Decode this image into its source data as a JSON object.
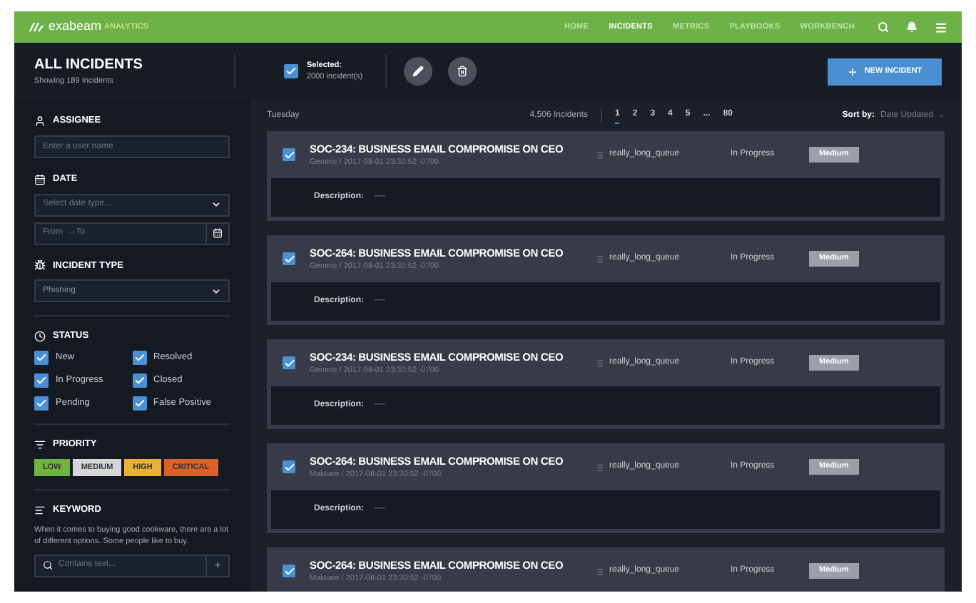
{
  "nav": {
    "logo": "exabeam",
    "logo_suffix": "ANALYTICS",
    "items": [
      {
        "label": "HOME",
        "selected": false
      },
      {
        "label": "INCIDENTS",
        "selected": true
      },
      {
        "label": "METRICS",
        "selected": false
      },
      {
        "label": "PLAYBOOKS",
        "selected": false
      },
      {
        "label": "WORKBENCH",
        "selected": false
      }
    ]
  },
  "header": {
    "title": "ALL INCIDENTS",
    "subtitle": "Showing 189 Incidents",
    "selection": {
      "checked": true,
      "label": "Selected:",
      "count": "2000 incident(s)"
    },
    "new_button": "NEW INCIDENT"
  },
  "filters": {
    "assignee": {
      "label": "ASSIGNEE",
      "placeholder": "Enter a user name"
    },
    "date": {
      "label": "DATE",
      "select_placeholder": "Select date type...",
      "range_placeholder": "From  →To"
    },
    "incident_type": {
      "label": "INCIDENT TYPE",
      "value": "Phishing"
    },
    "status": {
      "label": "STATUS",
      "options": [
        {
          "label": "New",
          "checked": true
        },
        {
          "label": "Resolved",
          "checked": true
        },
        {
          "label": "In Progress",
          "checked": true
        },
        {
          "label": "Closed",
          "checked": true
        },
        {
          "label": "Pending",
          "checked": true
        },
        {
          "label": "False Positive",
          "checked": true
        }
      ]
    },
    "priority": {
      "label": "PRIORITY",
      "options": [
        {
          "label": "LOW",
          "color": "#6db33f"
        },
        {
          "label": "MEDIUM",
          "color": "#d4d6d9"
        },
        {
          "label": "HIGH",
          "color": "#e8b23a"
        },
        {
          "label": "CRITICAL",
          "color": "#d9622b"
        }
      ]
    },
    "keyword": {
      "label": "KEYWORD",
      "hint": "When it comes to buying good cookware, there are a lot of different options. Some people like to buy.",
      "placeholder": "Contains text...",
      "add": "+"
    }
  },
  "list": {
    "day": "Tuesday",
    "count": "4,506 Incidents",
    "pages": [
      {
        "label": "1",
        "selected": true
      },
      {
        "label": "2",
        "selected": false
      },
      {
        "label": "3",
        "selected": false
      },
      {
        "label": "4",
        "selected": false
      },
      {
        "label": "5",
        "selected": false
      },
      {
        "label": "...",
        "selected": false
      },
      {
        "label": "80",
        "selected": false
      }
    ],
    "sort_label": "Sort by:",
    "sort_value": "Date Updated"
  },
  "incidents": [
    {
      "title": "SOC-234: BUSINESS EMAIL COMPROMISE ON CEO",
      "meta": "Generic / 2017-08-01 23:30:52 -0700",
      "queue": "really_long_queue",
      "status": "In Progress",
      "priority": "Medium",
      "checked": true,
      "description_label": "Description:",
      "description": "----"
    },
    {
      "title": "SOC-264: BUSINESS EMAIL COMPROMISE ON CEO",
      "meta": "Generic / 2017-08-01 23:30:52 -0700",
      "queue": "really_long_queue",
      "status": "In Progress",
      "priority": "Medium",
      "checked": true,
      "description_label": "Description:",
      "description": "----"
    },
    {
      "title": "SOC-234: BUSINESS EMAIL COMPROMISE ON CEO",
      "meta": "Generic / 2017-08-01 23:30:52 -0700",
      "queue": "really_long_queue",
      "status": "In Progress",
      "priority": "Medium",
      "checked": true,
      "description_label": "Description:",
      "description": "----"
    },
    {
      "title": "SOC-264: BUSINESS EMAIL COMPROMISE ON CEO",
      "meta": "Malware / 2017-08-01 23:30:52 -0700",
      "queue": "really_long_queue",
      "status": "In Progress",
      "priority": "Medium",
      "checked": true,
      "description_label": "Description:",
      "description": "----"
    },
    {
      "title": "SOC-264: BUSINESS EMAIL COMPROMISE ON CEO",
      "meta": "Malware / 2017-08-01 23:30:52 -0700",
      "queue": "really_long_queue",
      "status": "In Progress",
      "priority": "Medium",
      "checked": true
    }
  ]
}
